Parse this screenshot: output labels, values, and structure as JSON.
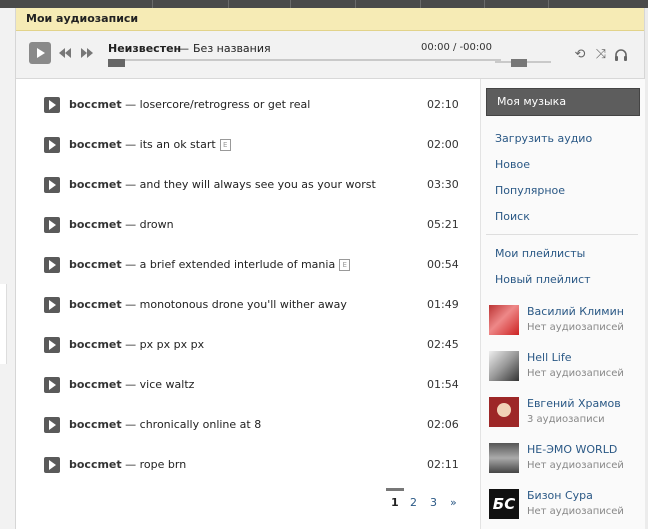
{
  "header": {
    "title": "Мои аудиозаписи"
  },
  "player": {
    "artist": "Неизвестен",
    "separator": "—",
    "title": "Без названия",
    "time": "00:00 / -00:00",
    "progress": 0,
    "volume": 0.4
  },
  "tracks": [
    {
      "artist": "boccmet",
      "title": "losercore/retrogress or get real",
      "explicit": false,
      "duration": "02:10"
    },
    {
      "artist": "boccmet",
      "title": "its an ok start",
      "explicit": true,
      "duration": "02:00"
    },
    {
      "artist": "boccmet",
      "title": "and they will always see you as your worst",
      "explicit": false,
      "duration": "03:30"
    },
    {
      "artist": "boccmet",
      "title": "drown",
      "explicit": false,
      "duration": "05:21"
    },
    {
      "artist": "boccmet",
      "title": "a brief extended interlude of mania",
      "explicit": true,
      "duration": "00:54"
    },
    {
      "artist": "boccmet",
      "title": "monotonous drone you'll wither away",
      "explicit": false,
      "duration": "01:49"
    },
    {
      "artist": "boccmet",
      "title": "px px px px",
      "explicit": false,
      "duration": "02:45"
    },
    {
      "artist": "boccmet",
      "title": "vice waltz",
      "explicit": false,
      "duration": "01:54"
    },
    {
      "artist": "boccmet",
      "title": "chronically online at 8",
      "explicit": false,
      "duration": "02:06"
    },
    {
      "artist": "boccmet",
      "title": "rope brn",
      "explicit": false,
      "duration": "02:11"
    }
  ],
  "track_separator": "—",
  "explicit_badge": "E",
  "pagination": {
    "pages": [
      "1",
      "2",
      "3"
    ],
    "current": "1",
    "next": "»"
  },
  "sidebar": {
    "active": "Моя музыка",
    "links": [
      "Загрузить аудио",
      "Новое",
      "Популярное",
      "Поиск"
    ],
    "playlist_links": [
      "Мои плейлисты",
      "Новый плейлист"
    ],
    "friends": [
      {
        "name": "Василий Климин",
        "status": "Нет аудиозаписей",
        "avatar": "photo-red"
      },
      {
        "name": "Hell Life",
        "status": "Нет аудиозаписей",
        "avatar": "photo-bw"
      },
      {
        "name": "Евгений Храмов",
        "status": "3 аудиозаписи",
        "avatar": "photo-drawing"
      },
      {
        "name": "НЕ-ЭМО WORLD",
        "status": "Нет аудиозаписей",
        "avatar": "photo-logo"
      },
      {
        "name": "Бизон Сура",
        "status": "Нет аудиозаписей",
        "avatar": "logo-text",
        "avatar_text": "БС"
      }
    ]
  },
  "colors": {
    "link": "#2a5885",
    "title_bar": "#f6ebb5",
    "active_item": "#5d5d5d"
  }
}
